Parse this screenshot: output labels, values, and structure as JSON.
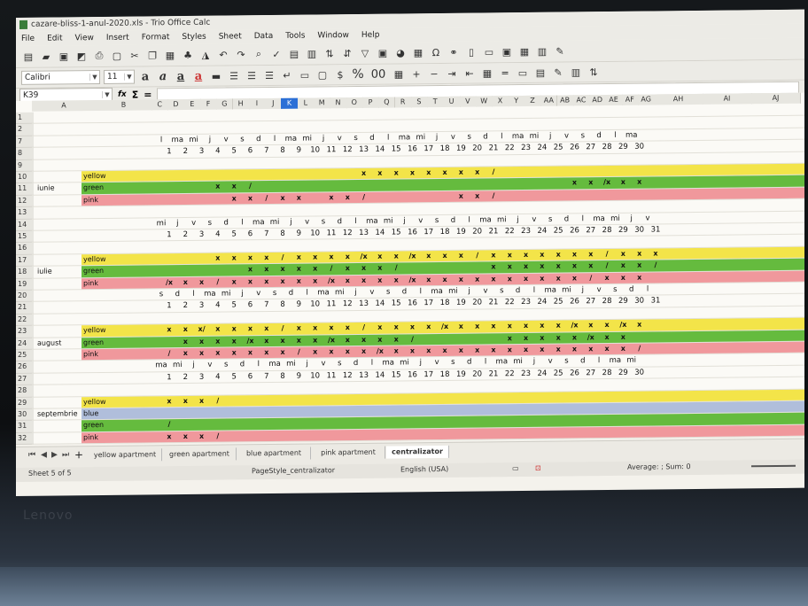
{
  "window": {
    "title": "cazare-bliss-1-anul-2020.xls - Trio Office Calc"
  },
  "menu": [
    "File",
    "Edit",
    "View",
    "Insert",
    "Format",
    "Styles",
    "Sheet",
    "Data",
    "Tools",
    "Window",
    "Help"
  ],
  "format_bar": {
    "font_name": "Calibri",
    "font_size": "11"
  },
  "formula_bar": {
    "cell_ref": "K39",
    "sum_symbol": "Σ",
    "equals_symbol": "="
  },
  "columns": [
    "A",
    "B",
    "C",
    "D",
    "E",
    "F",
    "G",
    "H",
    "I",
    "J",
    "K",
    "L",
    "M",
    "N",
    "O",
    "P",
    "Q",
    "R",
    "S",
    "T",
    "U",
    "V",
    "W",
    "X",
    "Y",
    "Z",
    "AA",
    "AB",
    "AC",
    "AD",
    "AE",
    "AF",
    "AG",
    "AH",
    "AI",
    "AJ"
  ],
  "selected_column": "K",
  "rows": [
    "1",
    "2",
    "7",
    "8",
    "9",
    "10",
    "11",
    "12",
    "13",
    "14",
    "15",
    "16",
    "17",
    "18",
    "19",
    "20",
    "21",
    "22",
    "23",
    "24",
    "25",
    "26",
    "27",
    "28",
    "29",
    "30",
    "31",
    "32"
  ],
  "apartments": {
    "yellow": "yellow",
    "green": "green",
    "blue": "blue",
    "pink": "pink"
  },
  "months": [
    {
      "name": "iunie",
      "weekdays": [
        "l",
        "ma",
        "mi",
        "j",
        "v",
        "s",
        "d",
        "l",
        "ma",
        "mi",
        "j",
        "v",
        "s",
        "d",
        "l",
        "ma",
        "mi",
        "j",
        "v",
        "s",
        "d",
        "l",
        "ma",
        "mi",
        "j",
        "v",
        "s",
        "d",
        "l",
        "ma"
      ],
      "days": [
        "1",
        "2",
        "3",
        "4",
        "5",
        "6",
        "7",
        "8",
        "9",
        "10",
        "11",
        "12",
        "13",
        "14",
        "15",
        "16",
        "17",
        "18",
        "19",
        "20",
        "21",
        "22",
        "23",
        "24",
        "25",
        "26",
        "27",
        "28",
        "29",
        "30"
      ],
      "rows": [
        {
          "apt": "yellow",
          "marks": [
            "",
            "",
            "",
            "",
            "",
            "",
            "",
            "",
            "",
            "",
            "",
            "",
            "x",
            "x",
            "x",
            "x",
            "x",
            "x",
            "x",
            "x",
            "/",
            "",
            "",
            "",
            "",
            "",
            "",
            "",
            "",
            ""
          ]
        },
        {
          "apt": "green",
          "marks": [
            "",
            "",
            "",
            "x",
            "x",
            "/",
            "",
            "",
            "",
            "",
            "",
            "",
            "",
            "",
            "",
            "",
            "",
            "",
            "",
            "",
            "",
            "",
            "",
            "",
            "",
            "x",
            "x",
            "/x",
            "x",
            "x"
          ]
        },
        {
          "apt": "pink",
          "marks": [
            "",
            "",
            "",
            "",
            "x",
            "x",
            "/",
            "x",
            "x",
            "",
            "x",
            "x",
            "/",
            "",
            "",
            "",
            "",
            "",
            "x",
            "x",
            "/",
            "",
            "",
            "",
            "",
            "",
            "",
            "",
            "",
            ""
          ]
        }
      ]
    },
    {
      "name": "iulie",
      "weekdays": [
        "mi",
        "j",
        "v",
        "s",
        "d",
        "l",
        "ma",
        "mi",
        "j",
        "v",
        "s",
        "d",
        "l",
        "ma",
        "mi",
        "j",
        "v",
        "s",
        "d",
        "l",
        "ma",
        "mi",
        "j",
        "v",
        "s",
        "d",
        "l",
        "ma",
        "mi",
        "j",
        "v"
      ],
      "days": [
        "1",
        "2",
        "3",
        "4",
        "5",
        "6",
        "7",
        "8",
        "9",
        "10",
        "11",
        "12",
        "13",
        "14",
        "15",
        "16",
        "17",
        "18",
        "19",
        "20",
        "21",
        "22",
        "23",
        "24",
        "25",
        "26",
        "27",
        "28",
        "29",
        "30",
        "31"
      ],
      "rows": [
        {
          "apt": "yellow",
          "marks": [
            "",
            "",
            "",
            "x",
            "x",
            "x",
            "x",
            "/",
            "x",
            "x",
            "x",
            "x",
            "/x",
            "x",
            "x",
            "/x",
            "x",
            "x",
            "x",
            "/",
            "x",
            "x",
            "x",
            "x",
            "x",
            "x",
            "x",
            "/",
            "x",
            "x",
            "x"
          ]
        },
        {
          "apt": "green",
          "marks": [
            "",
            "",
            "",
            "",
            "",
            "x",
            "x",
            "x",
            "x",
            "x",
            "/",
            "x",
            "x",
            "x",
            "/",
            "",
            "",
            "",
            "",
            "",
            "x",
            "x",
            "x",
            "x",
            "x",
            "x",
            "x",
            "/",
            "x",
            "x",
            "/"
          ]
        },
        {
          "apt": "pink",
          "marks": [
            "/x",
            "x",
            "x",
            "/",
            "x",
            "x",
            "x",
            "x",
            "x",
            "x",
            "/x",
            "x",
            "x",
            "x",
            "x",
            "/x",
            "x",
            "x",
            "x",
            "x",
            "x",
            "x",
            "x",
            "x",
            "x",
            "x",
            "/",
            "x",
            "x",
            "x",
            ""
          ]
        }
      ]
    },
    {
      "name": "august",
      "weekdays": [
        "s",
        "d",
        "l",
        "ma",
        "mi",
        "j",
        "v",
        "s",
        "d",
        "l",
        "ma",
        "mi",
        "j",
        "v",
        "s",
        "d",
        "l",
        "ma",
        "mi",
        "j",
        "v",
        "s",
        "d",
        "l",
        "ma",
        "mi",
        "j",
        "v",
        "s",
        "d",
        "l"
      ],
      "days": [
        "1",
        "2",
        "3",
        "4",
        "5",
        "6",
        "7",
        "8",
        "9",
        "10",
        "11",
        "12",
        "13",
        "14",
        "15",
        "16",
        "17",
        "18",
        "19",
        "20",
        "21",
        "22",
        "23",
        "24",
        "25",
        "26",
        "27",
        "28",
        "29",
        "30",
        "31"
      ],
      "rows": [
        {
          "apt": "yellow",
          "marks": [
            "x",
            "x",
            "x/",
            "x",
            "x",
            "x",
            "x",
            "/",
            "x",
            "x",
            "x",
            "x",
            "/",
            "x",
            "x",
            "x",
            "x",
            "/x",
            "x",
            "x",
            "x",
            "x",
            "x",
            "x",
            "x",
            "/x",
            "x",
            "x",
            "/x",
            "x",
            ""
          ]
        },
        {
          "apt": "green",
          "marks": [
            "",
            "x",
            "x",
            "x",
            "x",
            "/x",
            "x",
            "x",
            "x",
            "x",
            "/x",
            "x",
            "x",
            "x",
            "x",
            "/",
            "",
            "",
            "",
            "",
            "",
            "x",
            "x",
            "x",
            "x",
            "x",
            "/x",
            "x",
            "x",
            "",
            ""
          ]
        },
        {
          "apt": "pink",
          "marks": [
            "/",
            "x",
            "x",
            "x",
            "x",
            "x",
            "x",
            "x",
            "/",
            "x",
            "x",
            "x",
            "x",
            "/x",
            "x",
            "x",
            "x",
            "x",
            "x",
            "x",
            "x",
            "x",
            "x",
            "x",
            "x",
            "x",
            "x",
            "x",
            "x",
            "/",
            ""
          ]
        }
      ]
    },
    {
      "name": "septembrie",
      "weekdays": [
        "ma",
        "mi",
        "j",
        "v",
        "s",
        "d",
        "l",
        "ma",
        "mi",
        "j",
        "v",
        "s",
        "d",
        "l",
        "ma",
        "mi",
        "j",
        "v",
        "s",
        "d",
        "l",
        "ma",
        "mi",
        "j",
        "v",
        "s",
        "d",
        "l",
        "ma",
        "mi"
      ],
      "days": [
        "1",
        "2",
        "3",
        "4",
        "5",
        "6",
        "7",
        "8",
        "9",
        "10",
        "11",
        "12",
        "13",
        "14",
        "15",
        "16",
        "17",
        "18",
        "19",
        "20",
        "21",
        "22",
        "23",
        "24",
        "25",
        "26",
        "27",
        "28",
        "29",
        "30"
      ],
      "rows": [
        {
          "apt": "yellow",
          "marks": [
            "x",
            "x",
            "x",
            "/",
            "",
            "",
            "",
            "",
            "",
            "",
            "",
            "",
            "",
            "",
            "",
            "",
            "",
            "",
            "",
            "",
            "",
            "",
            "",
            "",
            "",
            "",
            "",
            "",
            "",
            ""
          ]
        },
        {
          "apt": "blue",
          "marks": [
            "",
            "",
            "",
            "",
            "",
            "",
            "",
            "",
            "",
            "",
            "",
            "",
            "",
            "",
            "",
            "",
            "",
            "",
            "",
            "",
            "",
            "",
            "",
            "",
            "",
            "",
            "",
            "",
            "",
            ""
          ]
        },
        {
          "apt": "green",
          "marks": [
            "/",
            "",
            "",
            "",
            "",
            "",
            "",
            "",
            "",
            "",
            "",
            "",
            "",
            "",
            "",
            "",
            "",
            "",
            "",
            "",
            "",
            "",
            "",
            "",
            "",
            "",
            "",
            "",
            "",
            ""
          ]
        },
        {
          "apt": "pink",
          "marks": [
            "x",
            "x",
            "x",
            "/",
            "",
            "",
            "",
            "",
            "",
            "",
            "",
            "",
            "",
            "",
            "",
            "",
            "",
            "",
            "",
            "",
            "",
            "",
            "",
            "",
            "",
            "",
            "",
            "",
            "",
            ""
          ]
        }
      ]
    }
  ],
  "sheet_tabs": [
    "yellow apartment",
    "green apartment",
    "blue apartment",
    "pink apartment",
    "centralizator"
  ],
  "active_tab": "centralizator",
  "status": {
    "sheet": "Sheet 5 of 5",
    "page_style": "PageStyle_centralizator",
    "language": "English (USA)",
    "sum": "Average: ; Sum: 0"
  },
  "bezel_brand": "Lenovo",
  "colors": {
    "yellow": "#f2e23a",
    "green": "#58b52e",
    "blue": "#a9b9d8",
    "pink": "#ef8f94",
    "selection": "#2b6fd6"
  }
}
